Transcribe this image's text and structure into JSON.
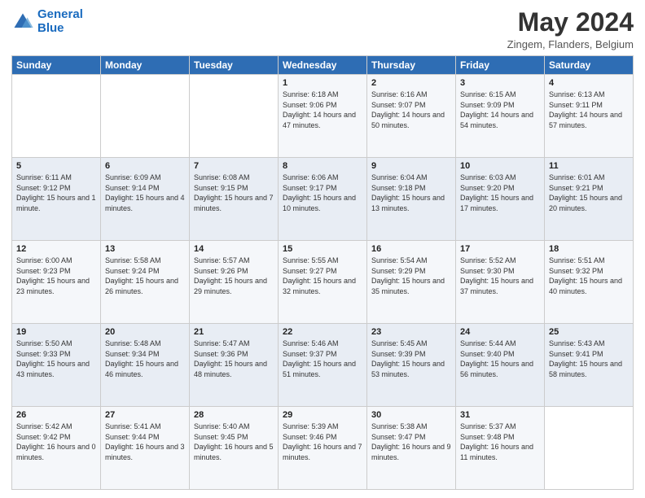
{
  "logo": {
    "line1": "General",
    "line2": "Blue"
  },
  "title": "May 2024",
  "location": "Zingem, Flanders, Belgium",
  "days_header": [
    "Sunday",
    "Monday",
    "Tuesday",
    "Wednesday",
    "Thursday",
    "Friday",
    "Saturday"
  ],
  "weeks": [
    [
      {
        "day": "",
        "info": ""
      },
      {
        "day": "",
        "info": ""
      },
      {
        "day": "",
        "info": ""
      },
      {
        "day": "1",
        "info": "Sunrise: 6:18 AM\nSunset: 9:06 PM\nDaylight: 14 hours and 47 minutes."
      },
      {
        "day": "2",
        "info": "Sunrise: 6:16 AM\nSunset: 9:07 PM\nDaylight: 14 hours and 50 minutes."
      },
      {
        "day": "3",
        "info": "Sunrise: 6:15 AM\nSunset: 9:09 PM\nDaylight: 14 hours and 54 minutes."
      },
      {
        "day": "4",
        "info": "Sunrise: 6:13 AM\nSunset: 9:11 PM\nDaylight: 14 hours and 57 minutes."
      }
    ],
    [
      {
        "day": "5",
        "info": "Sunrise: 6:11 AM\nSunset: 9:12 PM\nDaylight: 15 hours and 1 minute."
      },
      {
        "day": "6",
        "info": "Sunrise: 6:09 AM\nSunset: 9:14 PM\nDaylight: 15 hours and 4 minutes."
      },
      {
        "day": "7",
        "info": "Sunrise: 6:08 AM\nSunset: 9:15 PM\nDaylight: 15 hours and 7 minutes."
      },
      {
        "day": "8",
        "info": "Sunrise: 6:06 AM\nSunset: 9:17 PM\nDaylight: 15 hours and 10 minutes."
      },
      {
        "day": "9",
        "info": "Sunrise: 6:04 AM\nSunset: 9:18 PM\nDaylight: 15 hours and 13 minutes."
      },
      {
        "day": "10",
        "info": "Sunrise: 6:03 AM\nSunset: 9:20 PM\nDaylight: 15 hours and 17 minutes."
      },
      {
        "day": "11",
        "info": "Sunrise: 6:01 AM\nSunset: 9:21 PM\nDaylight: 15 hours and 20 minutes."
      }
    ],
    [
      {
        "day": "12",
        "info": "Sunrise: 6:00 AM\nSunset: 9:23 PM\nDaylight: 15 hours and 23 minutes."
      },
      {
        "day": "13",
        "info": "Sunrise: 5:58 AM\nSunset: 9:24 PM\nDaylight: 15 hours and 26 minutes."
      },
      {
        "day": "14",
        "info": "Sunrise: 5:57 AM\nSunset: 9:26 PM\nDaylight: 15 hours and 29 minutes."
      },
      {
        "day": "15",
        "info": "Sunrise: 5:55 AM\nSunset: 9:27 PM\nDaylight: 15 hours and 32 minutes."
      },
      {
        "day": "16",
        "info": "Sunrise: 5:54 AM\nSunset: 9:29 PM\nDaylight: 15 hours and 35 minutes."
      },
      {
        "day": "17",
        "info": "Sunrise: 5:52 AM\nSunset: 9:30 PM\nDaylight: 15 hours and 37 minutes."
      },
      {
        "day": "18",
        "info": "Sunrise: 5:51 AM\nSunset: 9:32 PM\nDaylight: 15 hours and 40 minutes."
      }
    ],
    [
      {
        "day": "19",
        "info": "Sunrise: 5:50 AM\nSunset: 9:33 PM\nDaylight: 15 hours and 43 minutes."
      },
      {
        "day": "20",
        "info": "Sunrise: 5:48 AM\nSunset: 9:34 PM\nDaylight: 15 hours and 46 minutes."
      },
      {
        "day": "21",
        "info": "Sunrise: 5:47 AM\nSunset: 9:36 PM\nDaylight: 15 hours and 48 minutes."
      },
      {
        "day": "22",
        "info": "Sunrise: 5:46 AM\nSunset: 9:37 PM\nDaylight: 15 hours and 51 minutes."
      },
      {
        "day": "23",
        "info": "Sunrise: 5:45 AM\nSunset: 9:39 PM\nDaylight: 15 hours and 53 minutes."
      },
      {
        "day": "24",
        "info": "Sunrise: 5:44 AM\nSunset: 9:40 PM\nDaylight: 15 hours and 56 minutes."
      },
      {
        "day": "25",
        "info": "Sunrise: 5:43 AM\nSunset: 9:41 PM\nDaylight: 15 hours and 58 minutes."
      }
    ],
    [
      {
        "day": "26",
        "info": "Sunrise: 5:42 AM\nSunset: 9:42 PM\nDaylight: 16 hours and 0 minutes."
      },
      {
        "day": "27",
        "info": "Sunrise: 5:41 AM\nSunset: 9:44 PM\nDaylight: 16 hours and 3 minutes."
      },
      {
        "day": "28",
        "info": "Sunrise: 5:40 AM\nSunset: 9:45 PM\nDaylight: 16 hours and 5 minutes."
      },
      {
        "day": "29",
        "info": "Sunrise: 5:39 AM\nSunset: 9:46 PM\nDaylight: 16 hours and 7 minutes."
      },
      {
        "day": "30",
        "info": "Sunrise: 5:38 AM\nSunset: 9:47 PM\nDaylight: 16 hours and 9 minutes."
      },
      {
        "day": "31",
        "info": "Sunrise: 5:37 AM\nSunset: 9:48 PM\nDaylight: 16 hours and 11 minutes."
      },
      {
        "day": "",
        "info": ""
      }
    ]
  ]
}
